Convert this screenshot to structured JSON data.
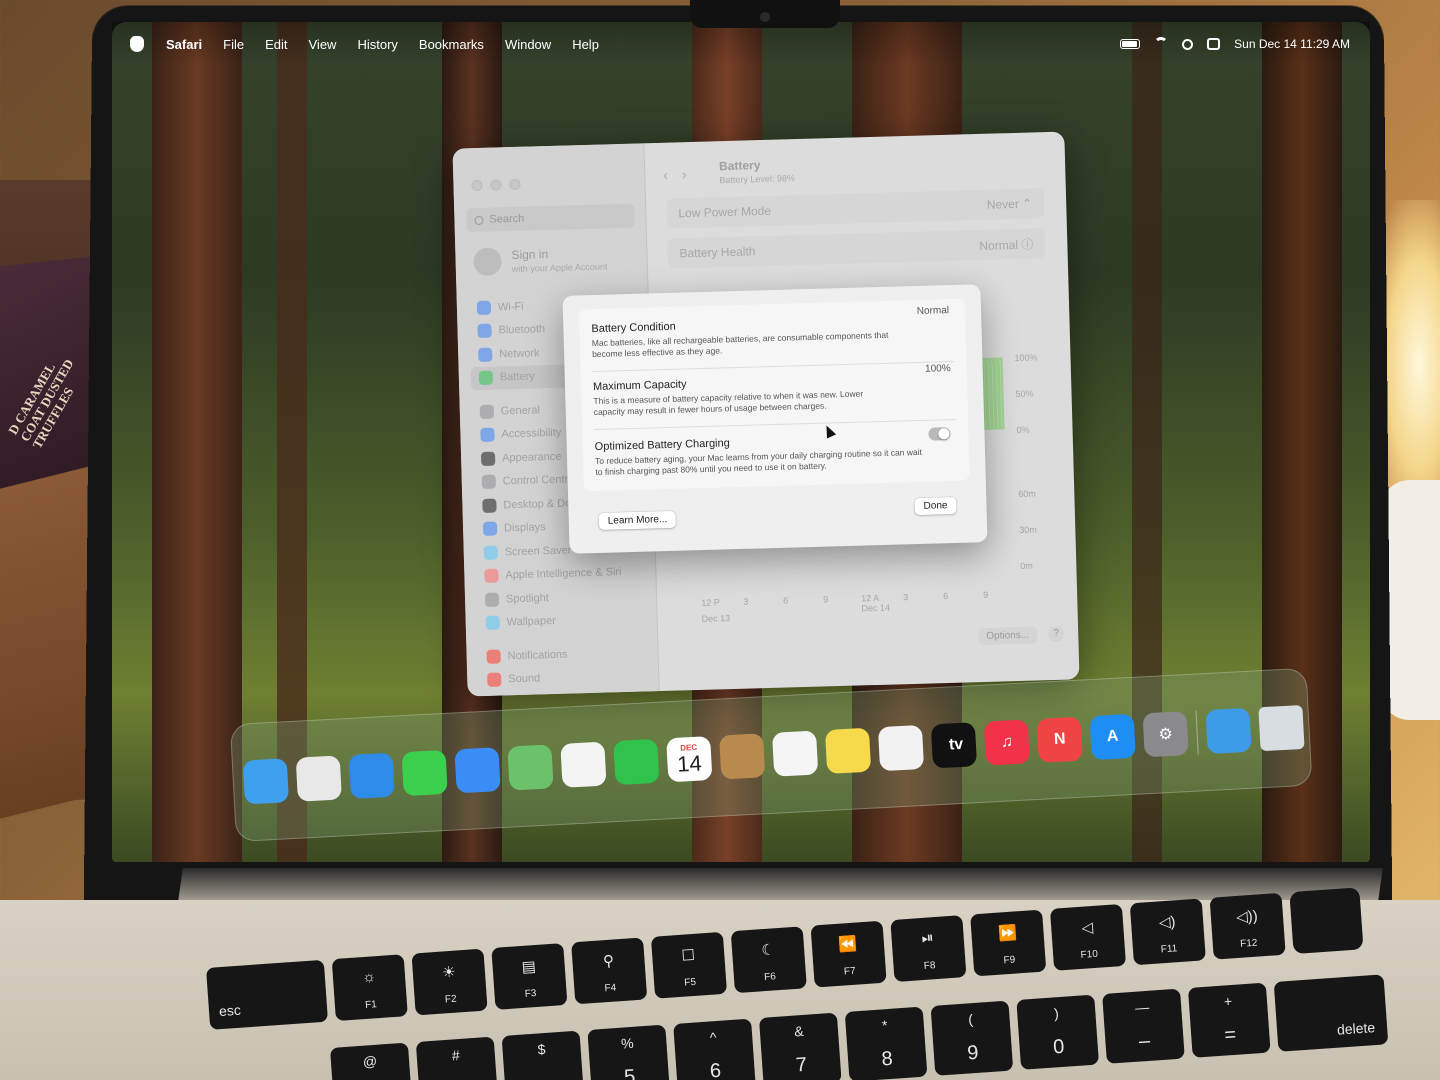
{
  "menubar": {
    "app": "Safari",
    "items": [
      "File",
      "Edit",
      "View",
      "History",
      "Bookmarks",
      "Window",
      "Help"
    ],
    "clock": "Sun Dec 14  11:29 AM"
  },
  "desk": {
    "bag_text": "D CARAMEL\nCOAT DUSTED\nTRUFFLES"
  },
  "settings": {
    "search_placeholder": "Search",
    "signin": {
      "title": "Sign in",
      "subtitle": "with your Apple Account"
    },
    "sidebar": [
      {
        "label": "Wi-Fi",
        "color": "#3b82f6"
      },
      {
        "label": "Bluetooth",
        "color": "#3b82f6"
      },
      {
        "label": "Network",
        "color": "#3b82f6"
      },
      {
        "label": "Battery",
        "color": "#34c759"
      },
      {
        "label": "General",
        "color": "#8e8e93"
      },
      {
        "label": "Accessibility",
        "color": "#3b82f6"
      },
      {
        "label": "Appearance",
        "color": "#1c1c1e"
      },
      {
        "label": "Control Centre",
        "color": "#8e8e93"
      },
      {
        "label": "Desktop & Dock",
        "color": "#1c1c1e"
      },
      {
        "label": "Displays",
        "color": "#3b82f6"
      },
      {
        "label": "Screen Saver",
        "color": "#5ac8fa"
      },
      {
        "label": "Apple Intelligence & Siri",
        "color": "#ff6b6b"
      },
      {
        "label": "Spotlight",
        "color": "#8e8e93"
      },
      {
        "label": "Wallpaper",
        "color": "#5ac8fa"
      },
      {
        "label": "Notifications",
        "color": "#ff3b30"
      },
      {
        "label": "Sound",
        "color": "#ff3b30"
      }
    ],
    "header": {
      "title": "Battery",
      "subtitle": "Battery Level: 98%"
    },
    "rows": [
      {
        "label": "Low Power Mode",
        "value": "Never ⌃"
      },
      {
        "label": "Battery Health",
        "value": "Normal ⓘ"
      }
    ],
    "chart": {
      "y_levels": [
        "100%",
        "50%",
        "0%"
      ],
      "y_usage": [
        "60m",
        "30m",
        "0m"
      ],
      "x_ticks": [
        "12 P",
        "3",
        "6",
        "9",
        "12 A",
        "3",
        "6",
        "9"
      ],
      "x_dates": [
        "Dec 13",
        "Dec 14"
      ]
    },
    "options_label": "Options...",
    "help_label": "?"
  },
  "modal": {
    "battery_condition": {
      "label": "Battery Condition",
      "value": "Normal",
      "desc": "Mac batteries, like all rechargeable batteries, are consumable components that become less effective as they age."
    },
    "max_capacity": {
      "label": "Maximum Capacity",
      "value": "100%",
      "desc": "This is a measure of battery capacity relative to when it was new. Lower capacity may result in fewer hours of usage between charges."
    },
    "optimized_charging": {
      "label": "Optimized Battery Charging",
      "desc": "To reduce battery aging, your Mac learns from your daily charging routine so it can wait to finish charging past 80% until you need to use it on battery.",
      "enabled": true
    },
    "learn_more": "Learn More...",
    "done": "Done"
  },
  "dock": {
    "calendar_month": "DEC",
    "calendar_day": "14",
    "apps": [
      {
        "name": "Finder",
        "color": "#3fa0f0"
      },
      {
        "name": "Launchpad",
        "color": "#e8e8e8"
      },
      {
        "name": "Safari",
        "color": "#2f8bea"
      },
      {
        "name": "Messages",
        "color": "#3ccf4e"
      },
      {
        "name": "Mail",
        "color": "#3a8df5"
      },
      {
        "name": "Maps",
        "color": "#6cc26a"
      },
      {
        "name": "Photos",
        "color": "#f4f4f4"
      },
      {
        "name": "FaceTime",
        "color": "#30c24b"
      },
      {
        "name": "Calendar",
        "color": "#ffffff"
      },
      {
        "name": "Contacts",
        "color": "#b98a4e"
      },
      {
        "name": "Reminders",
        "color": "#f5f5f5"
      },
      {
        "name": "Notes",
        "color": "#f7d94c"
      },
      {
        "name": "Freeform",
        "color": "#f2f2f2"
      },
      {
        "name": "TV",
        "color": "#111111",
        "glyph": " tv"
      },
      {
        "name": "Music",
        "color": "#f0324b",
        "glyph": "♫"
      },
      {
        "name": "News",
        "color": "#f04444",
        "glyph": "N"
      },
      {
        "name": "App Store",
        "color": "#1e8ef5",
        "glyph": "A"
      },
      {
        "name": "System Settings",
        "color": "#8a8a8e",
        "glyph": "⚙"
      }
    ],
    "downloads_color": "#3e9be8",
    "trash_color": "#d8dde2"
  },
  "keyboard": {
    "fn_row": [
      {
        "id": "esc",
        "top": "",
        "bottom": "esc"
      },
      {
        "id": "f1",
        "top": "☼",
        "bottom": "F1"
      },
      {
        "id": "f2",
        "top": "☀",
        "bottom": "F2"
      },
      {
        "id": "f3",
        "top": "▤",
        "bottom": "F3"
      },
      {
        "id": "f4",
        "top": "⚲",
        "bottom": "F4"
      },
      {
        "id": "f5",
        "top": "☐",
        "bottom": "F5"
      },
      {
        "id": "f6",
        "top": "☾",
        "bottom": "F6"
      },
      {
        "id": "f7",
        "top": "⏪",
        "bottom": "F7"
      },
      {
        "id": "f8",
        "top": "⏯",
        "bottom": "F8"
      },
      {
        "id": "f9",
        "top": "⏩",
        "bottom": "F9"
      },
      {
        "id": "f10",
        "top": "◁",
        "bottom": "F10"
      },
      {
        "id": "f11",
        "top": "◁)",
        "bottom": "F11"
      },
      {
        "id": "f12",
        "top": "◁))",
        "bottom": "F12"
      },
      {
        "id": "touchid",
        "top": "",
        "bottom": ""
      }
    ],
    "num_row": [
      {
        "top": "@",
        "bottom": ""
      },
      {
        "top": "#",
        "bottom": ""
      },
      {
        "top": "$",
        "bottom": ""
      },
      {
        "top": "%",
        "bottom": "5"
      },
      {
        "top": "^",
        "bottom": "6"
      },
      {
        "top": "&",
        "bottom": "7"
      },
      {
        "top": "*",
        "bottom": "8"
      },
      {
        "top": "(",
        "bottom": "9"
      },
      {
        "top": ")",
        "bottom": "0"
      },
      {
        "top": "—",
        "bottom": "–"
      },
      {
        "top": "+",
        "bottom": "="
      },
      {
        "top": "",
        "bottom": "delete"
      }
    ]
  }
}
